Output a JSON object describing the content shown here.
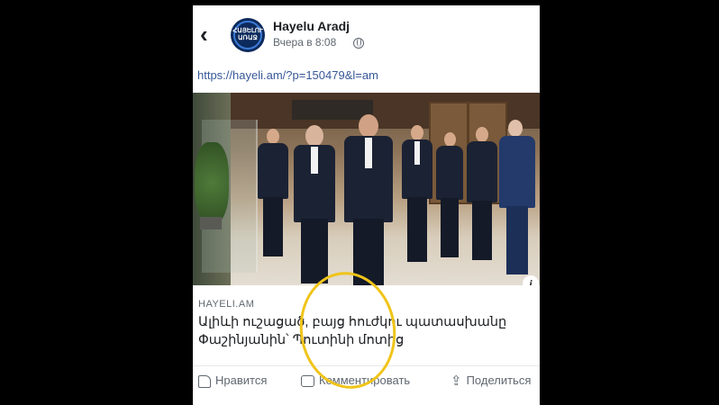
{
  "post": {
    "page_name": "Hayelu Aradj",
    "timestamp": "Вчера в 8:08",
    "avatar_text": "ՀԱՅԵԼՈՒ ԱՌԱՋ",
    "link": "https://hayeli.am/?p=150479&l=am",
    "domain": "HAYELI.AM",
    "headline": "Ալիևի ուշացած, բայց հուժկու պատասխանը Փաշինյանին՝ Պուտինի մոտից",
    "info_badge": "i"
  },
  "actions": {
    "like_label": "Нравится",
    "comment_label": "Комментировать",
    "share_label": "Поделиться"
  },
  "icons": {
    "back": "chevron-left-icon",
    "privacy": "globe-icon",
    "like": "thumbs-up-icon",
    "comment": "comment-icon",
    "share": "share-icon"
  },
  "colors": {
    "link": "#385898",
    "highlight": "#f0c419",
    "background": "#000000"
  }
}
